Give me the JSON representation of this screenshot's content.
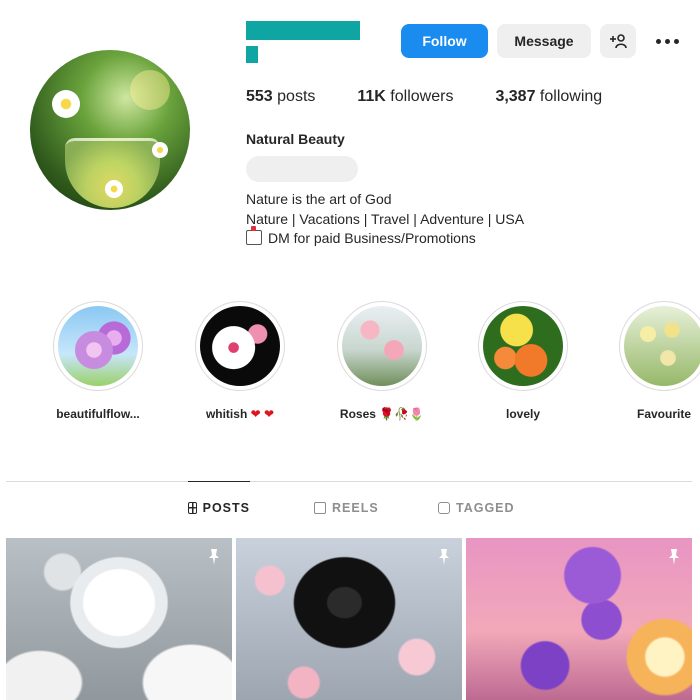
{
  "header": {
    "follow_label": "Follow",
    "message_label": "Message",
    "add_user_icon": "person-plus-icon",
    "more_icon": "more-dots-icon"
  },
  "stats": {
    "posts_count": "553",
    "posts_label": " posts",
    "followers_count": "11K",
    "followers_label": " followers",
    "following_count": "3,387",
    "following_label": " following"
  },
  "profile": {
    "full_name": "Natural Beauty",
    "bio_line_1": "Nature is the art of God",
    "bio_line_2": "Nature | Vacations | Travel | Adventure | USA",
    "bio_line_3": "DM for paid Business/Promotions"
  },
  "highlights": [
    {
      "label": "beautifulflow..."
    },
    {
      "label": "whitish ",
      "emoji": "❤ ❤"
    },
    {
      "label": "Roses 🌹🥀🌷"
    },
    {
      "label": "lovely"
    },
    {
      "label": "Favourite"
    }
  ],
  "tabs": {
    "posts": "POSTS",
    "reels": "REELS",
    "tagged": "TAGGED"
  },
  "colors": {
    "accent": "#1a8cf0",
    "redaction": "#0fa5a3",
    "button_gray": "#efefef"
  }
}
